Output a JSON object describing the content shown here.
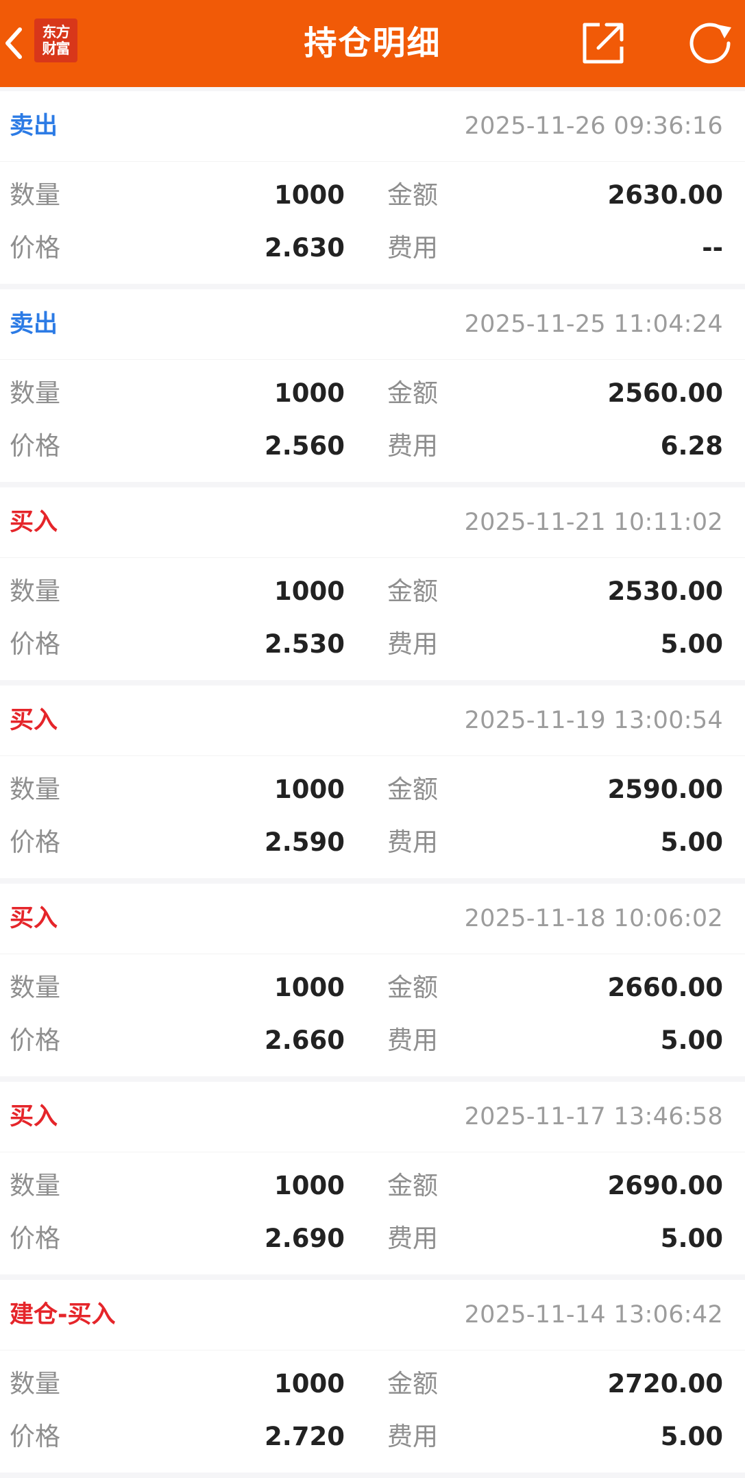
{
  "header": {
    "title": "持仓明细",
    "logo_line1": "东方",
    "logo_line2": "财富",
    "back_icon": "chevron-left-icon",
    "share_icon": "share-icon",
    "refresh_icon": "refresh-icon"
  },
  "colors": {
    "header_bg": "#f15a07",
    "sell": "#2c7be5",
    "buy": "#e5252a",
    "label": "#8e8e8e",
    "value": "#222222",
    "time": "#9c9c9c"
  },
  "labels": {
    "quantity": "数量",
    "amount": "金额",
    "price": "价格",
    "fee": "费用"
  },
  "records": [
    {
      "type": "卖出",
      "kind": "sell",
      "time": "2025-11-26 09:36:16",
      "quantity": "1000",
      "amount": "2630.00",
      "price": "2.630",
      "fee": "--"
    },
    {
      "type": "卖出",
      "kind": "sell",
      "time": "2025-11-25 11:04:24",
      "quantity": "1000",
      "amount": "2560.00",
      "price": "2.560",
      "fee": "6.28"
    },
    {
      "type": "买入",
      "kind": "buy",
      "time": "2025-11-21 10:11:02",
      "quantity": "1000",
      "amount": "2530.00",
      "price": "2.530",
      "fee": "5.00"
    },
    {
      "type": "买入",
      "kind": "buy",
      "time": "2025-11-19 13:00:54",
      "quantity": "1000",
      "amount": "2590.00",
      "price": "2.590",
      "fee": "5.00"
    },
    {
      "type": "买入",
      "kind": "buy",
      "time": "2025-11-18 10:06:02",
      "quantity": "1000",
      "amount": "2660.00",
      "price": "2.660",
      "fee": "5.00"
    },
    {
      "type": "买入",
      "kind": "buy",
      "time": "2025-11-17 13:46:58",
      "quantity": "1000",
      "amount": "2690.00",
      "price": "2.690",
      "fee": "5.00"
    },
    {
      "type": "建仓-买入",
      "kind": "buy",
      "time": "2025-11-14 13:06:42",
      "quantity": "1000",
      "amount": "2720.00",
      "price": "2.720",
      "fee": "5.00"
    }
  ]
}
